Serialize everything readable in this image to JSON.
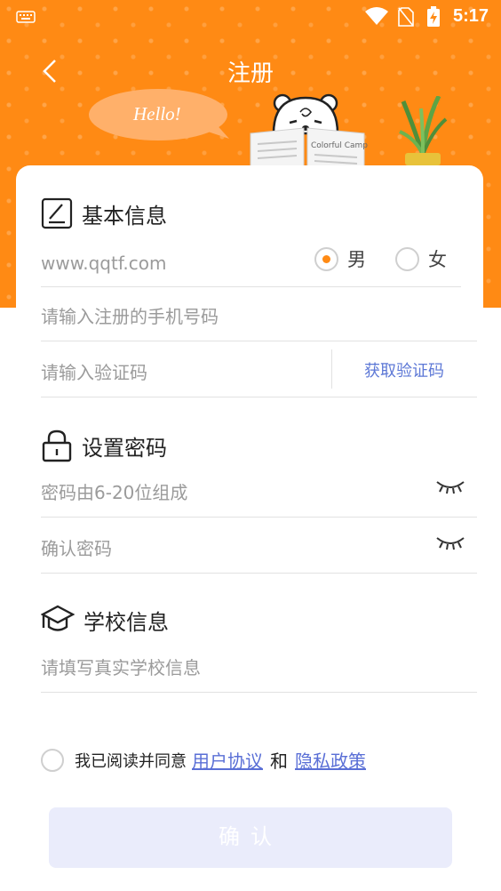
{
  "status_bar": {
    "time": "5:17"
  },
  "header": {
    "title": "注册",
    "greeting": "Hello!",
    "newspaper_text": "Colorful Campus"
  },
  "basic_info": {
    "section_title": "基本信息",
    "username_placeholder": "www.qqtf.com",
    "gender": {
      "male_label": "男",
      "female_label": "女",
      "selected": "男"
    },
    "phone_placeholder": "请输入注册的手机号码",
    "code_placeholder": "请输入验证码",
    "get_code_label": "获取验证码"
  },
  "password": {
    "section_title": "设置密码",
    "password_placeholder": "密码由6-20位组成",
    "confirm_placeholder": "确认密码"
  },
  "school": {
    "section_title": "学校信息",
    "school_placeholder": "请填写真实学校信息"
  },
  "agreement": {
    "prefix": "我已阅读并同意",
    "user_agreement": "用户协议",
    "and": "和",
    "privacy_policy": "隐私政策"
  },
  "confirm_label": "确认",
  "colors": {
    "brand": "#ff8a14",
    "link": "#5a6fd6",
    "button_disabled": "#eaecfb"
  },
  "icons": [
    "keyboard-icon",
    "wifi-icon",
    "sim-icon",
    "battery-icon",
    "back-icon",
    "edit-icon",
    "lock-icon",
    "graduation-cap-icon",
    "eye-closed-icon"
  ]
}
